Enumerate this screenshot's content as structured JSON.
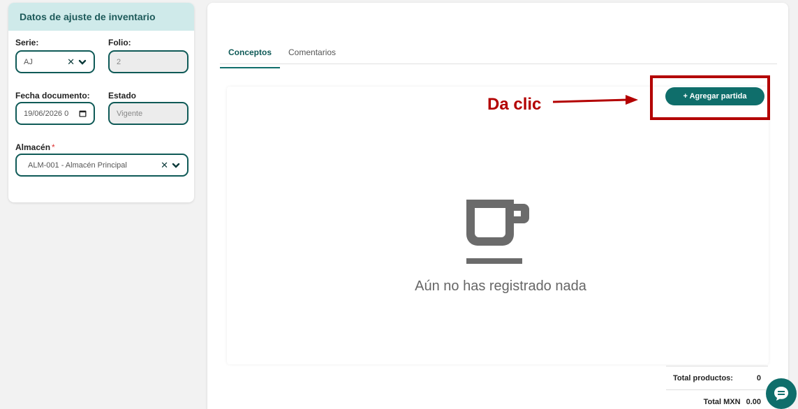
{
  "left": {
    "title": "Datos de ajuste de inventario",
    "serie": {
      "label": "Serie:",
      "value": "AJ"
    },
    "folio": {
      "label": "Folio:",
      "value": "2"
    },
    "fecha": {
      "label": "Fecha documento:",
      "value": "19/06/2026 0"
    },
    "estado": {
      "label": "Estado",
      "value": "Vigente"
    },
    "almacen": {
      "label": "Almacén",
      "required_mark": "*",
      "value": "ALM-001 - Almacén Principal"
    }
  },
  "tabs": [
    {
      "label": "Conceptos",
      "active": true
    },
    {
      "label": "Comentarios",
      "active": false
    }
  ],
  "add_button": {
    "label": "+ Agregar partida"
  },
  "annotation": {
    "text": "Da clic",
    "color": "#b30000"
  },
  "empty_state": {
    "icon": "coffee-cup-icon",
    "message": "Aún no has registrado nada"
  },
  "totals": [
    {
      "label": "Total productos:",
      "value": "0"
    },
    {
      "label": "Total MXN",
      "value": "0.00"
    }
  ],
  "colors": {
    "accent": "#0f6e6b",
    "header_bg": "#cfeaea",
    "annotation": "#b30000"
  }
}
